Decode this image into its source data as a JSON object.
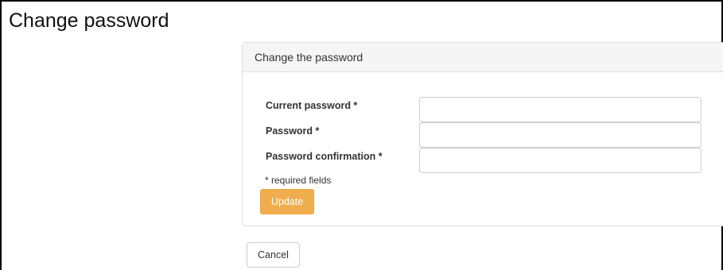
{
  "page": {
    "title": "Change password"
  },
  "panel": {
    "heading": "Change the password"
  },
  "form": {
    "fields": [
      {
        "label": "Current password *",
        "value": "",
        "placeholder": ""
      },
      {
        "label": "Password *",
        "value": "",
        "placeholder": ""
      },
      {
        "label": "Password confirmation *",
        "value": "",
        "placeholder": ""
      }
    ],
    "required_note": "* required fields",
    "update_label": "Update",
    "cancel_label": "Cancel"
  },
  "colors": {
    "update_button": "#f0ad4e",
    "panel_heading_bg": "#f5f5f5",
    "border": "#dddddd"
  }
}
